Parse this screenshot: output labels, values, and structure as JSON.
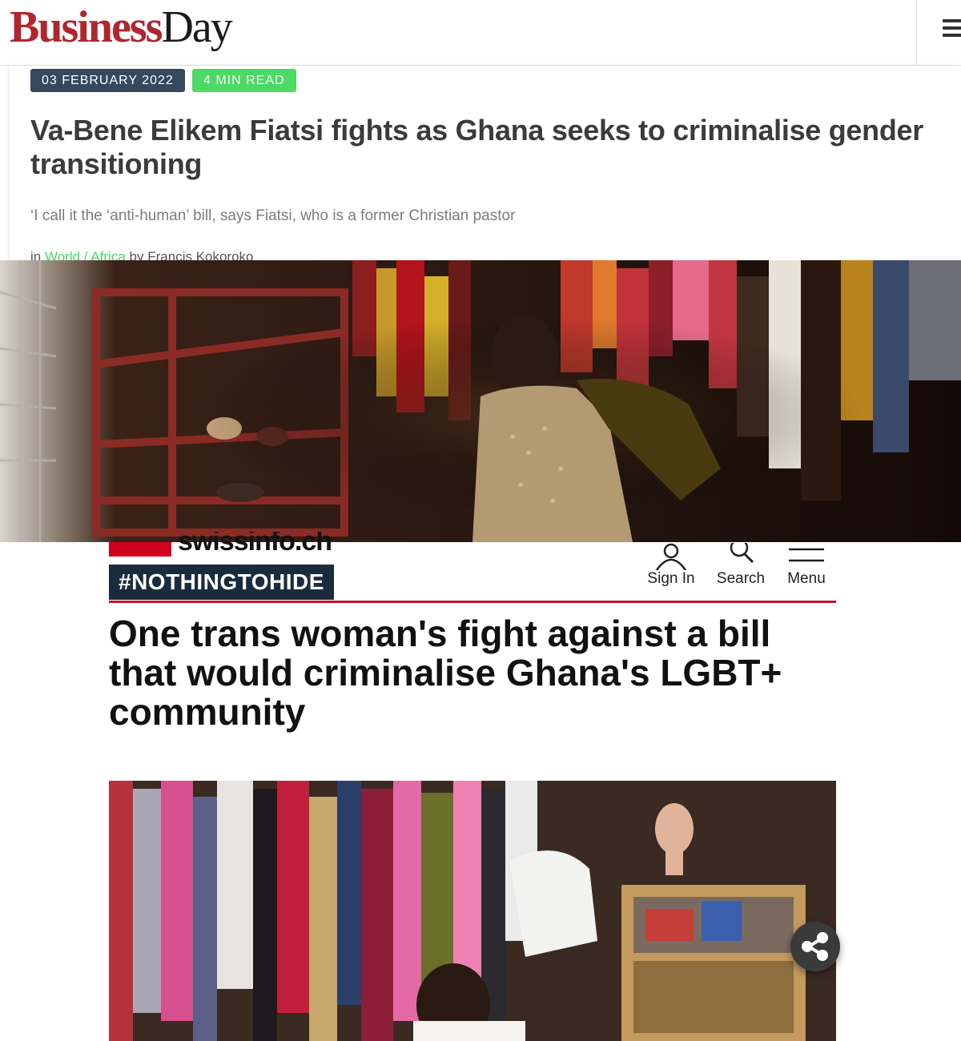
{
  "businessday": {
    "logo_business": "Business",
    "logo_day": "Day",
    "menu_icon": "hamburger-icon",
    "article": {
      "date": "03 FEBRUARY 2022",
      "read_time": "4 MIN READ",
      "title": "Va-Bene Elikem Fiatsi fights as Ghana seeks to criminalise gender transitioning",
      "subtitle": "‘I call it the ‘anti-human’ bill, says Fiatsi, who is a former Christian pastor",
      "byline_prefix": "in",
      "category_1": "World",
      "separator": "/",
      "category_2": "Africa",
      "byline_by": "by",
      "author": "Francis Kokoroko"
    },
    "colors": {
      "brand_red": "#b0262c",
      "date_badge": "#34495e",
      "read_badge": "#4cd964"
    }
  },
  "swissinfo": {
    "logo_text": "swissinfo.ch",
    "tag": "#NOTHINGTOHIDE",
    "nav": {
      "sign_in": {
        "label": "Sign In",
        "icon": "user-icon"
      },
      "search": {
        "label": "Search",
        "icon": "search-icon"
      },
      "menu": {
        "label": "Menu",
        "icon": "menu-icon"
      }
    },
    "title": "One trans woman's fight against a bill that would criminalise Ghana's LGBT+ community",
    "share_icon": "share-icon",
    "colors": {
      "accent_red": "#c8102e",
      "tag_bg": "#1b2b3e"
    }
  }
}
